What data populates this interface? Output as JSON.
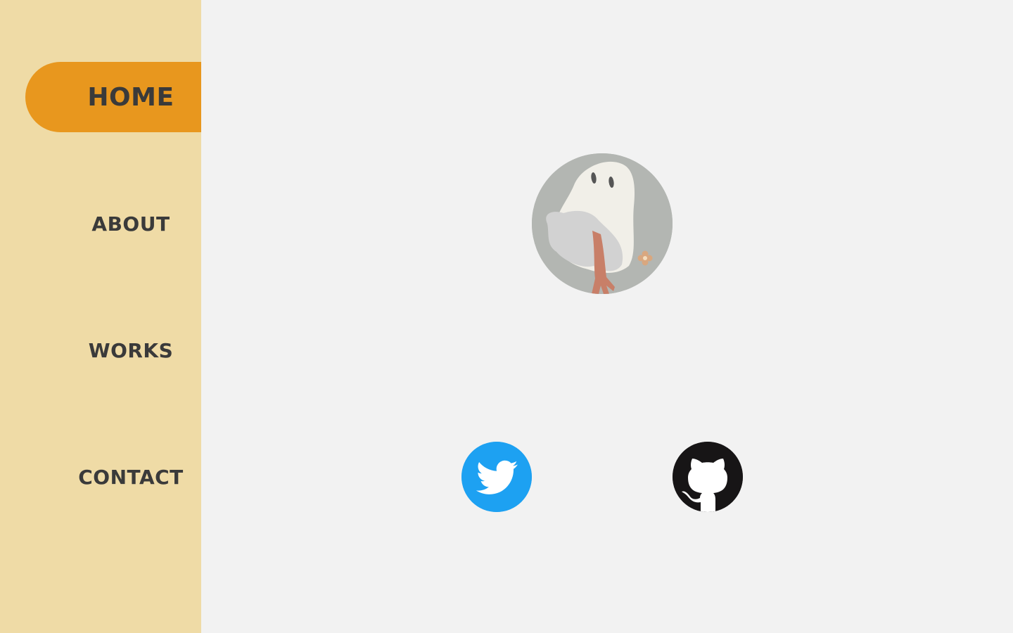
{
  "nav": {
    "items": [
      {
        "label": "HOME",
        "active": true
      },
      {
        "label": "ABOUT",
        "active": false
      },
      {
        "label": "WORKS",
        "active": false
      },
      {
        "label": "CONTACT",
        "active": false
      }
    ]
  },
  "profile": {
    "avatar_icon": "ghost-avatar-icon"
  },
  "social": {
    "twitter": {
      "icon": "twitter-bird-icon",
      "color": "#1da1f2"
    },
    "github": {
      "icon": "github-octocat-icon",
      "color": "#171516"
    }
  },
  "colors": {
    "sidebar_bg": "#efdba6",
    "active_tab": "#e8971e",
    "page_bg": "#f2f2f2",
    "nav_text": "#3a3a3a"
  }
}
